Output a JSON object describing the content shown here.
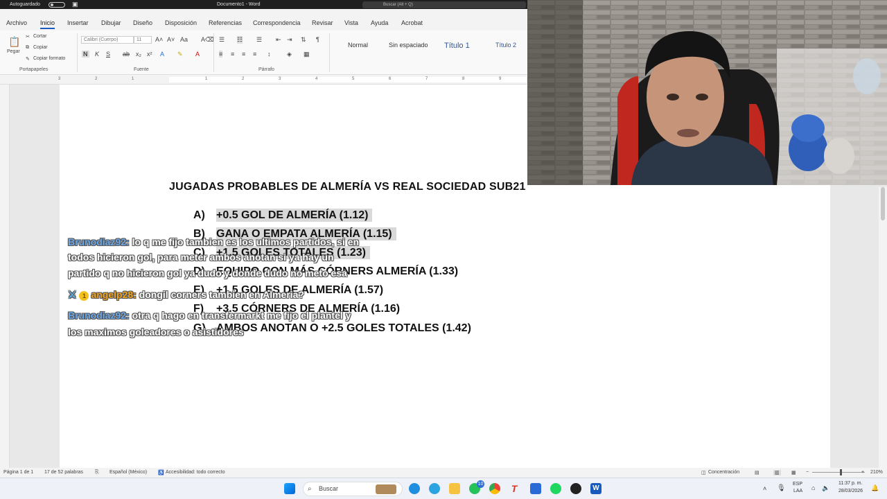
{
  "title_bar": {
    "autosave": "Autoguardado",
    "doc_title": "Documento1 - Word",
    "search_placeholder": "Buscar (Alt + Q)"
  },
  "menu": [
    "Archivo",
    "Inicio",
    "Insertar",
    "Dibujar",
    "Diseño",
    "Disposición",
    "Referencias",
    "Correspondencia",
    "Revisar",
    "Vista",
    "Ayuda",
    "Acrobat"
  ],
  "ribbon": {
    "paste": "Pegar",
    "cut": "Cortar",
    "copy": "Copiar",
    "format_painter": "Copiar formato",
    "font_name": "Calibri (Cuerpo)",
    "font_size": "11",
    "group_clipboard": "Portapapeles",
    "group_font": "Fuente",
    "group_paragraph": "Párrafo",
    "styles": [
      "Normal",
      "Sin espaciado",
      "Título 1",
      "Título 2"
    ]
  },
  "ruler_numbers": [
    "3",
    "2",
    "1",
    "1",
    "2",
    "3",
    "4",
    "5",
    "6",
    "7",
    "8",
    "9"
  ],
  "document": {
    "title": "JUGADAS PROBABLES DE ALMERÍA VS REAL SOCIEDAD SUB21",
    "options": [
      {
        "letter": "A)",
        "text": "+0.5 GOL DE ALMERÍA (1.12)",
        "highlighted": true
      },
      {
        "letter": "B)",
        "text": "GANA O EMPATA ALMERÍA (1.15)",
        "highlighted": true
      },
      {
        "letter": "C)",
        "text": "+1.5 GOLES TOTALES (1.23)",
        "highlighted": true
      },
      {
        "letter": "D)",
        "text": "EQUIPO CON MÁS CÓRNERS ALMERÍA (1.33)",
        "highlighted": false
      },
      {
        "letter": "E)",
        "text": "+1.5 GOLES DE ALMERÍA (1.57)",
        "highlighted": false
      },
      {
        "letter": "F)",
        "text": "+3.5 CÓRNERS DE ALMERÍA (1.16)",
        "highlighted": false
      },
      {
        "letter": "G)",
        "text": "AMBOS ANOTAN O +2.5 GOLES TOTALES (1.42)",
        "highlighted": false
      }
    ]
  },
  "chat": [
    {
      "user": "Brunodiaz92:",
      "lines": [
        " lo q me fijo tambien es los ultimos partidos, si en",
        "todos hicieron gol, para meter ambos anotan si ya hay un",
        "partido q no hicieron gol ya dudo y donde dudo no meto esa"
      ]
    },
    {
      "user": "angelp28:",
      "badge": "1",
      "lines": [
        " dongil corners tambien en Almeria?"
      ]
    },
    {
      "user": "Brunodiaz92:",
      "lines": [
        " otra q hago en transfermarkt me fijo el plantel y",
        "los maximos goleadores o asistidores"
      ]
    }
  ],
  "status_bar": {
    "page": "Página 1 de 1",
    "words": "17 de 52 palabras",
    "language": "Español (México)",
    "accessibility": "Accesibilidad: todo correcto",
    "focus": "Concentración",
    "zoom": "210%"
  },
  "taskbar": {
    "search": "Buscar",
    "whatsapp_badge": "10",
    "lang": "ESP",
    "region": "LAA",
    "time": "11:37 p. m.",
    "date": "28/03/2026"
  },
  "colors": {
    "accent": "#185abd",
    "highlight": "#d9d9d9",
    "chat_user1": "#6aa7e8",
    "chat_user2": "#f2a31c"
  }
}
